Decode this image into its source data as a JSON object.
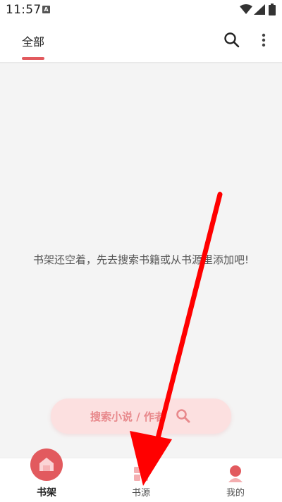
{
  "status_bar": {
    "time": "11:57",
    "badge": "A"
  },
  "header": {
    "tabs": [
      {
        "label": "全部",
        "active": true
      }
    ],
    "icons": [
      "search-icon",
      "more-vert-icon"
    ]
  },
  "content": {
    "empty_message": "书架还空着，先去搜索书籍或从书源里添加吧!",
    "search_button_label": "搜索小说 / 作者"
  },
  "bottom_nav": {
    "items": [
      {
        "label": "书架",
        "icon": "bookshelf-icon",
        "active": true
      },
      {
        "label": "书源",
        "icon": "source-grid-icon",
        "active": false
      },
      {
        "label": "我的",
        "icon": "profile-icon",
        "active": false
      }
    ]
  },
  "colors": {
    "accent": "#e25a5e",
    "button_bg": "#fce0e0",
    "content_bg": "#f4f4f4",
    "annotation_arrow": "#ff0000"
  }
}
